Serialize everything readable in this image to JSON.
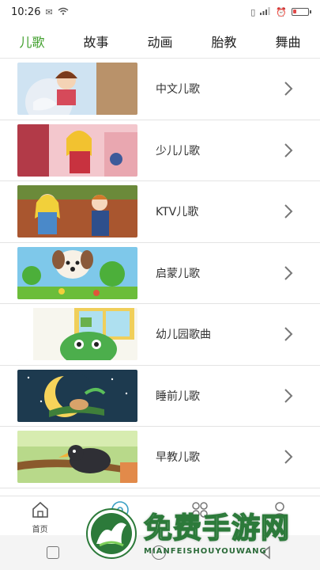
{
  "status_bar": {
    "time": "10:26",
    "left_icons": [
      "notification-icon",
      "wifi-icon"
    ],
    "right_icons": [
      "vibrate-icon",
      "signal-icon",
      "alarm-icon",
      "battery-icon"
    ],
    "battery_level": 0.2
  },
  "tabs": [
    {
      "label": "儿歌",
      "active": true
    },
    {
      "label": "故事",
      "active": false
    },
    {
      "label": "动画",
      "active": false
    },
    {
      "label": "胎教",
      "active": false
    },
    {
      "label": "舞曲",
      "active": false
    }
  ],
  "list": {
    "items": [
      {
        "title": "中文儿歌"
      },
      {
        "title": "少儿儿歌"
      },
      {
        "title": "KTV儿歌"
      },
      {
        "title": "启蒙儿歌"
      },
      {
        "title": "幼儿园歌曲"
      },
      {
        "title": "睡前儿歌"
      },
      {
        "title": "早教儿歌"
      }
    ]
  },
  "bottom_nav": [
    {
      "label": "首页",
      "icon": "home-icon"
    },
    {
      "label": "",
      "icon": "music-disc-icon"
    },
    {
      "label": "",
      "icon": "grid-icon"
    },
    {
      "label": "",
      "icon": "user-icon"
    }
  ],
  "watermark": {
    "title": "免费手游网",
    "subtitle": "MIANFEISHOUYOUWANG"
  },
  "colors": {
    "accent": "#3f9e2b",
    "divider": "#e3e3e3"
  }
}
